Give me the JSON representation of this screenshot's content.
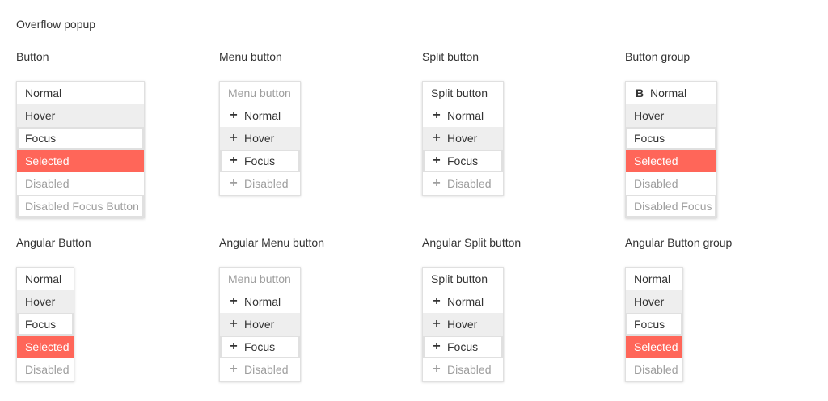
{
  "page_title": "Overflow popup",
  "sections": {
    "button": {
      "title": "Button",
      "items": [
        "Normal",
        "Hover",
        "Focus",
        "Selected",
        "Disabled",
        "Disabled Focus Button"
      ]
    },
    "menu_button": {
      "title": "Menu button",
      "header": "Menu button",
      "items": [
        "Normal",
        "Hover",
        "Focus",
        "Disabled"
      ]
    },
    "split_button": {
      "title": "Split button",
      "header": "Split button",
      "items": [
        "Normal",
        "Hover",
        "Focus",
        "Disabled"
      ]
    },
    "button_group": {
      "title": "Button group",
      "bold_glyph": "B",
      "items": [
        "Normal",
        "Hover",
        "Focus",
        "Selected",
        "Disabled",
        "Disabled Focus"
      ]
    },
    "angular_button": {
      "title": "Angular Button",
      "items": [
        "Normal",
        "Hover",
        "Focus",
        "Selected",
        "Disabled"
      ]
    },
    "angular_menu_button": {
      "title": "Angular Menu button",
      "header": "Menu button",
      "items": [
        "Normal",
        "Hover",
        "Focus",
        "Disabled"
      ]
    },
    "angular_split_button": {
      "title": "Angular Split button",
      "header": "Split button",
      "items": [
        "Normal",
        "Hover",
        "Focus",
        "Disabled"
      ]
    },
    "angular_button_group": {
      "title": "Angular Button group",
      "items": [
        "Normal",
        "Hover",
        "Focus",
        "Selected",
        "Disabled"
      ]
    }
  },
  "icons": {
    "plus": "+"
  },
  "colors": {
    "selected_bg": "#ff6659",
    "hover_bg": "#eeeeee",
    "disabled_text": "#9e9e9e",
    "focus_border": "#e0e0e0"
  }
}
